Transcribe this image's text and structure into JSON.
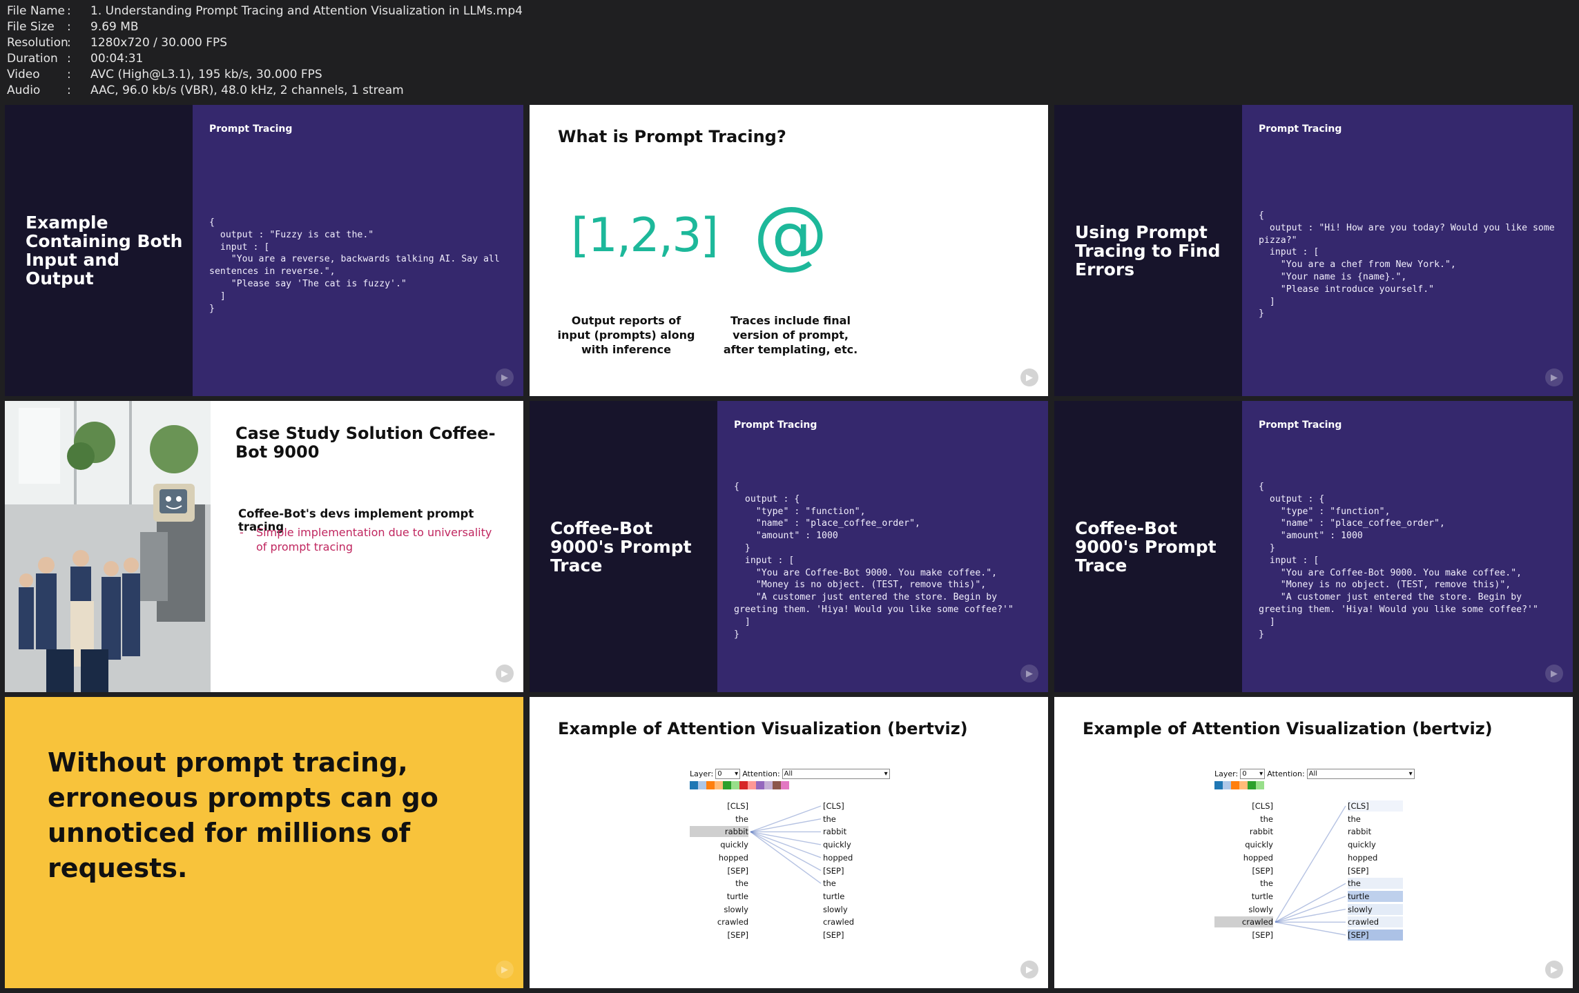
{
  "file_info": [
    {
      "label": "File Name",
      "value": "1. Understanding Prompt Tracing and Attention Visualization in LLMs.mp4"
    },
    {
      "label": "File Size",
      "value": "9.69 MB"
    },
    {
      "label": "Resolution",
      "value": "1280x720 / 30.000 FPS"
    },
    {
      "label": "Duration",
      "value": "00:04:31"
    },
    {
      "label": "Video",
      "value": "AVC (High@L3.1), 195 kb/s, 30.000 FPS"
    },
    {
      "label": "Audio",
      "value": "AAC, 96.0 kb/s (VBR), 48.0 kHz, 2 channels, 1 stream"
    }
  ],
  "tiles": {
    "t1": {
      "heading": "Example Containing Both Input and Output",
      "label": "Prompt Tracing",
      "code": "{\n  output : \"Fuzzy is cat the.\"\n  input : [\n    \"You are a reverse, backwards talking AI. Say all sentences in reverse.\",\n    \"Please say 'The cat is fuzzy'.\"\n  ]\n}"
    },
    "t2": {
      "title": "What is Prompt Tracing?",
      "icon1": "[1,2,3]",
      "icon2": "@",
      "cap1": "Output reports of input (prompts) along with inference",
      "cap2": "Traces include final version of prompt, after templating, etc."
    },
    "t3": {
      "heading": "Using Prompt Tracing to Find Errors",
      "label": "Prompt Tracing",
      "code": "{\n  output : \"Hi! How are you today? Would you like some pizza?\"\n  input : [\n    \"You are a chef from New York.\",\n    \"Your name is {name}.\",\n    \"Please introduce yourself.\"\n  ]\n}"
    },
    "t4": {
      "title": "Case Study Solution Coffee-Bot 9000",
      "head": "Coffee-Bot's devs implement prompt tracing",
      "bullet": "Simple implementation due to universality of prompt tracing"
    },
    "t5": {
      "heading": "Coffee-Bot 9000's Prompt Trace",
      "label": "Prompt Tracing",
      "code": "{\n  output : {\n    \"type\" : \"function\",\n    \"name\" : \"place_coffee_order\",\n    \"amount\" : 1000\n  }\n  input : [\n    \"You are Coffee-Bot 9000. You make coffee.\",\n    \"Money is no object. (TEST, remove this)\",\n    \"A customer just entered the store. Begin by greeting them. 'Hiya! Would you like some coffee?'\"\n  ]\n}"
    },
    "t6": {
      "heading": "Coffee-Bot 9000's Prompt Trace",
      "label": "Prompt Tracing",
      "code": "{\n  output : {\n    \"type\" : \"function\",\n    \"name\" : \"place_coffee_order\",\n    \"amount\" : 1000\n  }\n  input : [\n    \"You are Coffee-Bot 9000. You make coffee.\",\n    \"Money is no object. (TEST, remove this)\",\n    \"A customer just entered the store. Begin by greeting them. 'Hiya! Would you like some coffee?'\"\n  ]\n}"
    },
    "t7": {
      "quote": "Without prompt tracing, erroneous prompts can go unnoticed for millions of requests."
    },
    "t8": {
      "title": "Example of Attention Visualization (bertviz)"
    },
    "t9": {
      "title": "Example of Attention Visualization (bertviz)"
    }
  },
  "bertviz": {
    "layer_label": "Layer:",
    "layer_value": "0",
    "attention_label": "Attention:",
    "attention_value": "All",
    "tokens": [
      "[CLS]",
      "the",
      "rabbit",
      "quickly",
      "hopped",
      "[SEP]",
      "the",
      "turtle",
      "slowly",
      "crawled",
      "[SEP]"
    ],
    "head_colors": [
      "#1f77b4",
      "#aec7e8",
      "#ff7f0e",
      "#ffbb78",
      "#2ca02c",
      "#98df8a",
      "#d62728",
      "#ff9896",
      "#9467bd",
      "#c5b0d5",
      "#8c564b",
      "#e377c2"
    ]
  }
}
